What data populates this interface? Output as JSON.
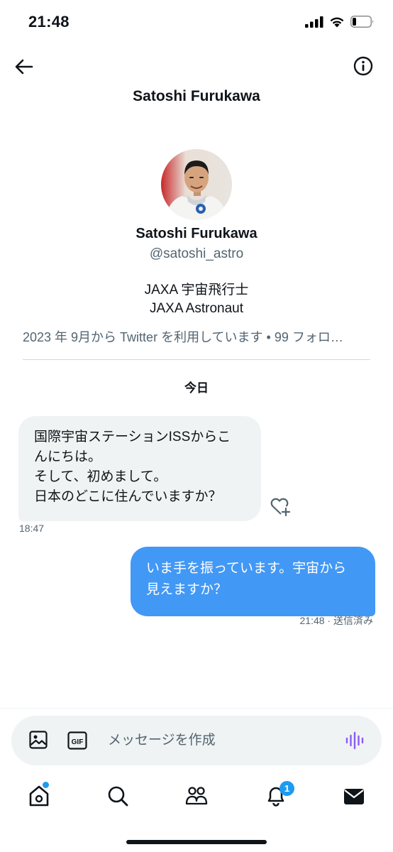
{
  "status_bar": {
    "time": "21:48"
  },
  "header": {
    "title": "Satoshi Furukawa"
  },
  "profile": {
    "name": "Satoshi Furukawa",
    "handle": "@satoshi_astro",
    "bio_line1": "JAXA 宇宙飛行士",
    "bio_line2": "JAXA Astronaut",
    "meta": "2023 年 9月から Twitter を利用しています • 99 フォロ…"
  },
  "conversation": {
    "date_separator": "今日",
    "messages": [
      {
        "direction": "incoming",
        "lines": [
          "国際宇宙ステーションISSからこ",
          "んにちは。",
          "そして、初めまして。",
          "日本のどこに住んでいますか？"
        ],
        "time": "18:47"
      },
      {
        "direction": "outgoing",
        "lines": [
          "いま手を振っています。宇宙から",
          "見えますか？"
        ],
        "time": "21:48 · 送信済み"
      }
    ]
  },
  "composer": {
    "placeholder": "メッセージを作成"
  },
  "tab_bar": {
    "notifications_badge": "1"
  },
  "colors": {
    "accent": "#1d9bf0",
    "outgoing_bubble": "#4298f5",
    "incoming_bubble": "#eff3f4",
    "voice_icon": "#8b5cf6"
  }
}
